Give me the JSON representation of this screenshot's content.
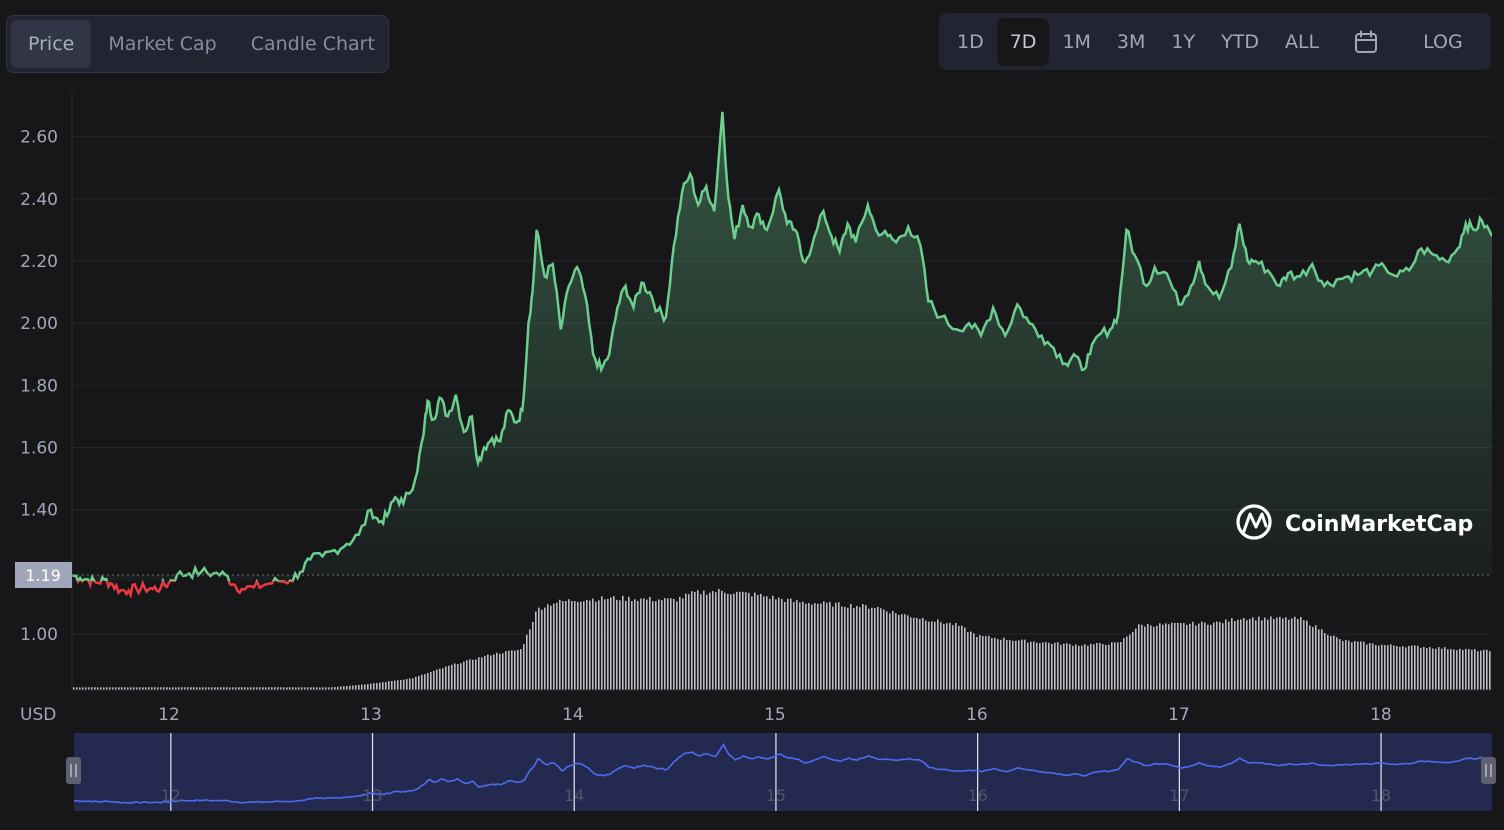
{
  "tabs": [
    {
      "label": "Price",
      "active": true
    },
    {
      "label": "Market Cap",
      "active": false
    },
    {
      "label": "Candle Chart",
      "active": false
    }
  ],
  "ranges": [
    {
      "label": "1D",
      "active": false
    },
    {
      "label": "7D",
      "active": true
    },
    {
      "label": "1M",
      "active": false
    },
    {
      "label": "3M",
      "active": false
    },
    {
      "label": "1Y",
      "active": false
    },
    {
      "label": "YTD",
      "active": false
    },
    {
      "label": "ALL",
      "active": false
    }
  ],
  "calendar_icon": "calendar-icon",
  "log_label": "LOG",
  "watermark": "CoinMarketCap",
  "colors": {
    "up": "#6ccf8e",
    "down": "#ea3943",
    "navigator": "#4c6cf0",
    "volume": "#d8dbe3"
  },
  "chart_data": {
    "type": "line",
    "title": "",
    "xlabel": "",
    "ylabel": "USD",
    "currency_label": "USD",
    "x_ticks": [
      "12",
      "13",
      "14",
      "15",
      "16",
      "17",
      "18"
    ],
    "y_ticks": [
      "1.00",
      "1.40",
      "1.60",
      "1.80",
      "2.00",
      "2.20",
      "2.40",
      "2.60"
    ],
    "ylim": [
      0.82,
      2.75
    ],
    "xlim": [
      11.52,
      18.55
    ],
    "reference_price": 1.19,
    "reference_label": "1.19",
    "grid": true,
    "series": [
      {
        "values": [
          [
            11.52,
            1.19
          ],
          [
            11.56,
            1.18
          ],
          [
            11.6,
            1.175
          ],
          [
            11.64,
            1.165
          ],
          [
            11.68,
            1.175
          ],
          [
            11.72,
            1.16
          ],
          [
            11.76,
            1.14
          ],
          [
            11.8,
            1.14
          ],
          [
            11.84,
            1.145
          ],
          [
            11.88,
            1.148
          ],
          [
            11.92,
            1.145
          ],
          [
            11.96,
            1.15
          ],
          [
            12.0,
            1.165
          ],
          [
            12.04,
            1.19
          ],
          [
            12.1,
            1.195
          ],
          [
            12.16,
            1.2
          ],
          [
            12.22,
            1.195
          ],
          [
            12.28,
            1.19
          ],
          [
            12.32,
            1.16
          ],
          [
            12.36,
            1.145
          ],
          [
            12.42,
            1.15
          ],
          [
            12.48,
            1.16
          ],
          [
            12.54,
            1.17
          ],
          [
            12.6,
            1.172
          ],
          [
            12.65,
            1.2
          ],
          [
            12.7,
            1.24
          ],
          [
            12.76,
            1.25
          ],
          [
            12.82,
            1.27
          ],
          [
            12.88,
            1.29
          ],
          [
            12.94,
            1.32
          ],
          [
            13.0,
            1.4
          ],
          [
            13.04,
            1.36
          ],
          [
            13.08,
            1.38
          ],
          [
            13.12,
            1.44
          ],
          [
            13.16,
            1.42
          ],
          [
            13.22,
            1.5
          ],
          [
            13.26,
            1.64
          ],
          [
            13.28,
            1.75
          ],
          [
            13.31,
            1.69
          ],
          [
            13.34,
            1.76
          ],
          [
            13.38,
            1.7
          ],
          [
            13.42,
            1.77
          ],
          [
            13.46,
            1.65
          ],
          [
            13.5,
            1.7
          ],
          [
            13.53,
            1.55
          ],
          [
            13.56,
            1.6
          ],
          [
            13.6,
            1.63
          ],
          [
            13.64,
            1.62
          ],
          [
            13.68,
            1.72
          ],
          [
            13.72,
            1.68
          ],
          [
            13.75,
            1.72
          ],
          [
            13.78,
            2.0
          ],
          [
            13.8,
            2.1
          ],
          [
            13.82,
            2.3
          ],
          [
            13.86,
            2.15
          ],
          [
            13.9,
            2.19
          ],
          [
            13.94,
            1.98
          ],
          [
            13.98,
            2.12
          ],
          [
            14.02,
            2.18
          ],
          [
            14.06,
            2.09
          ],
          [
            14.1,
            1.9
          ],
          [
            14.14,
            1.85
          ],
          [
            14.18,
            1.9
          ],
          [
            14.22,
            2.05
          ],
          [
            14.26,
            2.12
          ],
          [
            14.3,
            2.05
          ],
          [
            14.34,
            2.13
          ],
          [
            14.38,
            2.1
          ],
          [
            14.42,
            2.04
          ],
          [
            14.46,
            2.02
          ],
          [
            14.5,
            2.25
          ],
          [
            14.54,
            2.42
          ],
          [
            14.58,
            2.48
          ],
          [
            14.62,
            2.38
          ],
          [
            14.66,
            2.44
          ],
          [
            14.7,
            2.36
          ],
          [
            14.74,
            2.68
          ],
          [
            14.77,
            2.4
          ],
          [
            14.8,
            2.27
          ],
          [
            14.84,
            2.38
          ],
          [
            14.88,
            2.31
          ],
          [
            14.92,
            2.35
          ],
          [
            14.96,
            2.3
          ],
          [
            15.02,
            2.43
          ],
          [
            15.06,
            2.32
          ],
          [
            15.1,
            2.3
          ],
          [
            15.14,
            2.2
          ],
          [
            15.18,
            2.24
          ],
          [
            15.24,
            2.36
          ],
          [
            15.28,
            2.28
          ],
          [
            15.32,
            2.23
          ],
          [
            15.36,
            2.32
          ],
          [
            15.4,
            2.26
          ],
          [
            15.46,
            2.38
          ],
          [
            15.5,
            2.3
          ],
          [
            15.56,
            2.28
          ],
          [
            15.6,
            2.26
          ],
          [
            15.66,
            2.31
          ],
          [
            15.72,
            2.25
          ],
          [
            15.76,
            2.07
          ],
          [
            15.82,
            2.02
          ],
          [
            15.9,
            1.98
          ],
          [
            15.96,
            2.0
          ],
          [
            16.02,
            1.96
          ],
          [
            16.08,
            2.05
          ],
          [
            16.14,
            1.96
          ],
          [
            16.2,
            2.06
          ],
          [
            16.26,
            2.0
          ],
          [
            16.32,
            1.96
          ],
          [
            16.38,
            1.92
          ],
          [
            16.44,
            1.87
          ],
          [
            16.48,
            1.9
          ],
          [
            16.52,
            1.85
          ],
          [
            16.56,
            1.9
          ],
          [
            16.6,
            1.96
          ],
          [
            16.66,
            1.98
          ],
          [
            16.7,
            2.03
          ],
          [
            16.74,
            2.3
          ],
          [
            16.78,
            2.22
          ],
          [
            16.84,
            2.12
          ],
          [
            16.88,
            2.18
          ],
          [
            16.94,
            2.16
          ],
          [
            17.0,
            2.06
          ],
          [
            17.06,
            2.12
          ],
          [
            17.1,
            2.2
          ],
          [
            17.14,
            2.12
          ],
          [
            17.2,
            2.08
          ],
          [
            17.26,
            2.18
          ],
          [
            17.3,
            2.32
          ],
          [
            17.34,
            2.2
          ],
          [
            17.38,
            2.2
          ],
          [
            17.44,
            2.17
          ],
          [
            17.5,
            2.12
          ],
          [
            17.54,
            2.16
          ],
          [
            17.6,
            2.15
          ],
          [
            17.66,
            2.19
          ],
          [
            17.72,
            2.12
          ],
          [
            17.78,
            2.14
          ],
          [
            17.84,
            2.15
          ],
          [
            17.9,
            2.16
          ],
          [
            17.96,
            2.17
          ],
          [
            18.02,
            2.18
          ],
          [
            18.08,
            2.15
          ],
          [
            18.14,
            2.17
          ],
          [
            18.2,
            2.24
          ],
          [
            18.26,
            2.22
          ],
          [
            18.32,
            2.2
          ],
          [
            18.38,
            2.24
          ],
          [
            18.42,
            2.32
          ],
          [
            18.46,
            2.3
          ],
          [
            18.5,
            2.33
          ],
          [
            18.55,
            2.28
          ]
        ]
      }
    ],
    "volume": [
      [
        11.52,
        0.03
      ],
      [
        12.0,
        0.03
      ],
      [
        12.5,
        0.03
      ],
      [
        12.8,
        0.03
      ],
      [
        13.0,
        0.07
      ],
      [
        13.2,
        0.13
      ],
      [
        13.4,
        0.28
      ],
      [
        13.6,
        0.4
      ],
      [
        13.74,
        0.45
      ],
      [
        13.82,
        0.9
      ],
      [
        13.9,
        0.97
      ],
      [
        14.0,
        1.0
      ],
      [
        14.2,
        1.02
      ],
      [
        14.5,
        1.0
      ],
      [
        14.6,
        1.08
      ],
      [
        14.72,
        1.1
      ],
      [
        14.9,
        1.06
      ],
      [
        15.1,
        0.98
      ],
      [
        15.3,
        0.95
      ],
      [
        15.5,
        0.92
      ],
      [
        15.6,
        0.85
      ],
      [
        15.9,
        0.72
      ],
      [
        16.0,
        0.6
      ],
      [
        16.2,
        0.55
      ],
      [
        16.5,
        0.5
      ],
      [
        16.7,
        0.52
      ],
      [
        16.8,
        0.72
      ],
      [
        17.0,
        0.73
      ],
      [
        17.2,
        0.75
      ],
      [
        17.3,
        0.8
      ],
      [
        17.6,
        0.79
      ],
      [
        17.8,
        0.55
      ],
      [
        18.0,
        0.5
      ],
      [
        18.2,
        0.48
      ],
      [
        18.55,
        0.43
      ]
    ]
  }
}
